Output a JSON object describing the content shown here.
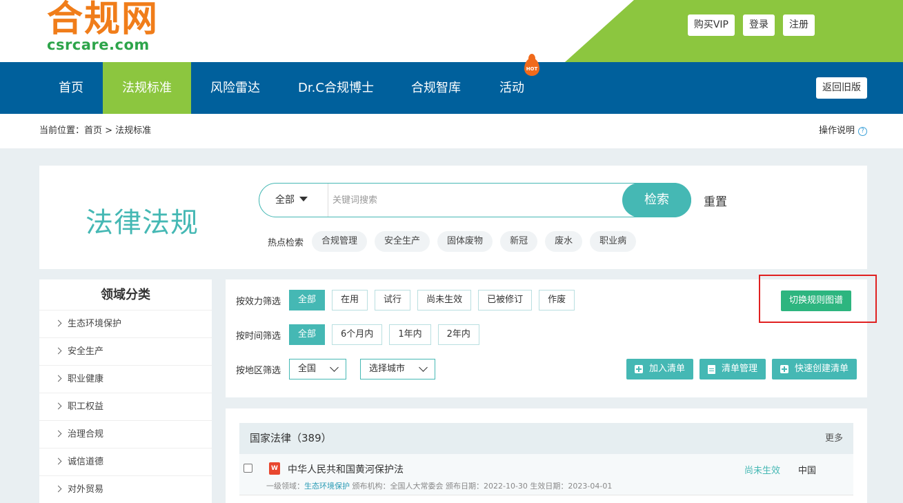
{
  "header": {
    "logo_cn": "合规网",
    "logo_en": "csrcare.com",
    "buttons": [
      "购买VIP",
      "登录",
      "注册"
    ]
  },
  "nav": {
    "items": [
      "首页",
      "法规标准",
      "风险雷达",
      "Dr.C合规博士",
      "合规智库",
      "活动"
    ],
    "active_index": 1,
    "hot_badge": "HOT",
    "old_version": "返回旧版"
  },
  "breadcrumb": {
    "text": "当前位置：首页 > 法规标准",
    "help": "操作说明",
    "help_icon": "?"
  },
  "search": {
    "title": "法律法规",
    "scope": "全部",
    "placeholder": "关键词搜索",
    "button": "检索",
    "reset": "重置",
    "hot_label": "热点检索",
    "hot_tags": [
      "合规管理",
      "安全生产",
      "固体废物",
      "新冠",
      "废水",
      "职业病"
    ]
  },
  "sidebar": {
    "title": "领域分类",
    "items": [
      "生态环境保护",
      "安全生产",
      "职业健康",
      "职工权益",
      "治理合规",
      "诚信道德",
      "对外贸易"
    ]
  },
  "filters": {
    "validity_label": "按效力筛选",
    "validity": [
      "全部",
      "在用",
      "试行",
      "尚未生效",
      "已被修订",
      "作废"
    ],
    "time_label": "按时间筛选",
    "time": [
      "全部",
      "6个月内",
      "1年内",
      "2年内"
    ],
    "region_label": "按地区筛选",
    "region_value": "全国",
    "city_value": "选择城市",
    "switch_button": "切换规则图谱",
    "actions": [
      "加入清单",
      "清单管理",
      "快速创建清单"
    ]
  },
  "list": {
    "title": "国家法律（389）",
    "more": "更多",
    "rows": [
      {
        "title": "中华人民共和国黄河保护法",
        "meta_prefix": "一级领域：",
        "field": "生态环境保护",
        "meta_rest": " 颁布机构：全国人大常委会 颁布日期：2022-10-30 生效日期：2023-04-01",
        "status": "尚未生效",
        "region": "中国",
        "file_icon": "W"
      }
    ]
  }
}
